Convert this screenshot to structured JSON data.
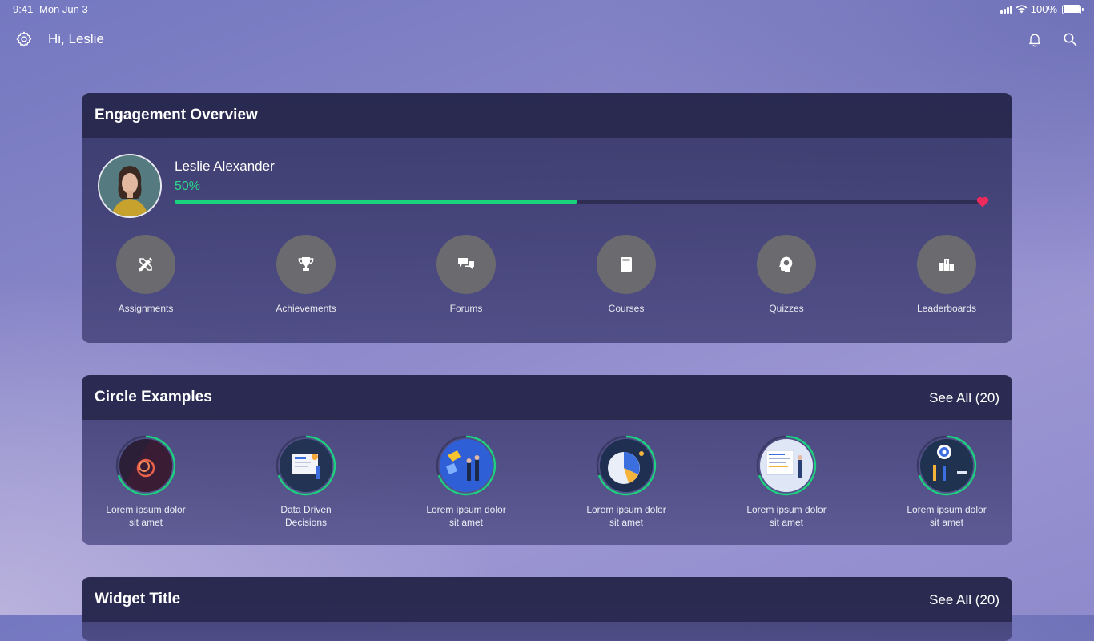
{
  "status_bar": {
    "time": "9:41",
    "date": "Mon Jun 3",
    "battery": "100%"
  },
  "header": {
    "greeting": "Hi, Leslie"
  },
  "engagement": {
    "title": "Engagement Overview",
    "user_name": "Leslie Alexander",
    "progress_label": "50%",
    "progress_value": 0.5,
    "nav": [
      {
        "label": "Assignments",
        "icon": "pencil-ruler-icon"
      },
      {
        "label": "Achievements",
        "icon": "trophy-icon"
      },
      {
        "label": "Forums",
        "icon": "chat-bubbles-icon"
      },
      {
        "label": "Courses",
        "icon": "book-icon"
      },
      {
        "label": "Quizzes",
        "icon": "brain-head-icon"
      },
      {
        "label": "Leaderboards",
        "icon": "podium-icon"
      }
    ]
  },
  "circles": {
    "title": "Circle Examples",
    "see_all": "See All (20)",
    "items": [
      {
        "line1": "Lorem ipsum dolor",
        "line2": "sit amet"
      },
      {
        "line1": "Data Driven",
        "line2": "Decisions"
      },
      {
        "line1": "Lorem ipsum dolor",
        "line2": "sit amet"
      },
      {
        "line1": "Lorem ipsum dolor",
        "line2": "sit amet"
      },
      {
        "line1": "Lorem ipsum dolor",
        "line2": "sit amet"
      },
      {
        "line1": "Lorem ipsum dolor",
        "line2": "sit amet"
      }
    ]
  },
  "widget": {
    "title": "Widget Title",
    "see_all": "See All (20)"
  },
  "colors": {
    "accent_green": "#19d37d",
    "heart": "#ee2a5c",
    "icon_circle": "#6b6a6e"
  }
}
